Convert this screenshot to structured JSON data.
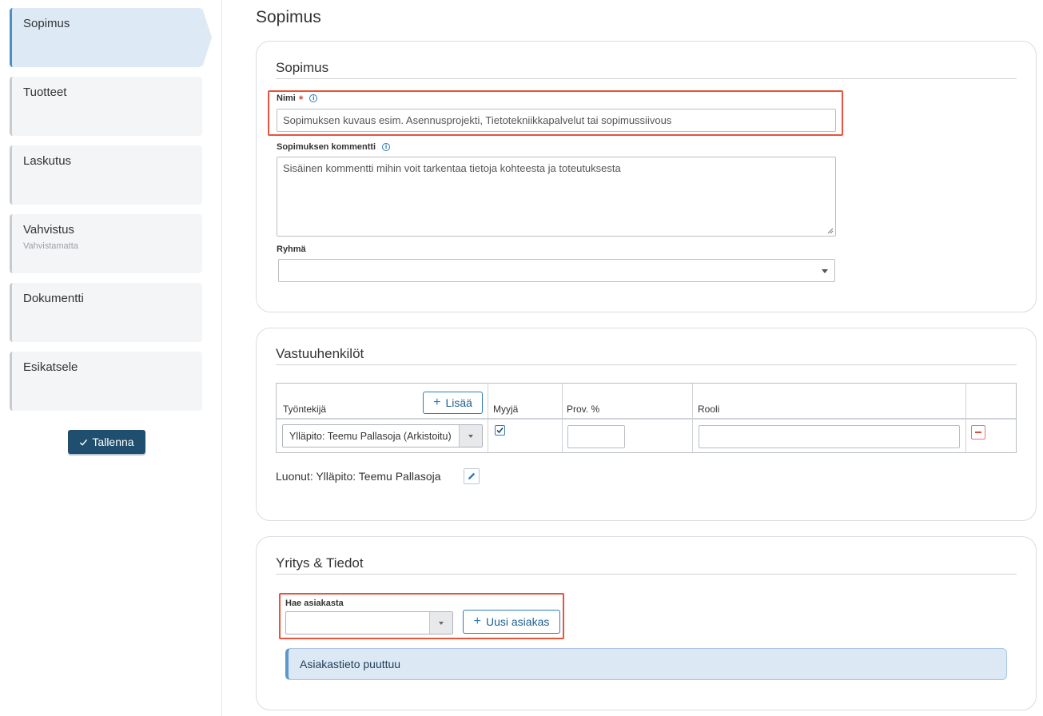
{
  "sidebar": {
    "items": [
      {
        "label": "Sopimus",
        "sub": ""
      },
      {
        "label": "Tuotteet",
        "sub": ""
      },
      {
        "label": "Laskutus",
        "sub": ""
      },
      {
        "label": "Vahvistus",
        "sub": "Vahvistamatta"
      },
      {
        "label": "Dokumentti",
        "sub": ""
      },
      {
        "label": "Esikatsele",
        "sub": ""
      }
    ],
    "active_index": 0,
    "save_label": "Tallenna"
  },
  "page": {
    "title": "Sopimus"
  },
  "contract_card": {
    "title": "Sopimus",
    "name_label": "Nimi",
    "name_required_mark": "*",
    "name_placeholder": "Sopimuksen kuvaus esim. Asennusprojekti, Tietotekniikkapalvelut tai sopimussiivous",
    "comment_label": "Sopimuksen kommentti",
    "comment_placeholder": "Sisäinen kommentti mihin voit tarkentaa tietoja kohteesta ja toteutuksesta",
    "group_label": "Ryhmä",
    "group_value": ""
  },
  "responsible_card": {
    "title": "Vastuuhenkilöt",
    "columns": {
      "employee": "Työntekijä",
      "seller": "Myyjä",
      "commission": "Prov. %",
      "role": "Rooli"
    },
    "add_label": "Lisää",
    "rows": [
      {
        "employee": "Ylläpito: Teemu Pallasoja (Arkistoitu)",
        "seller": true,
        "commission": "",
        "role": ""
      }
    ],
    "created_by": "Luonut: Ylläpito: Teemu Pallasoja"
  },
  "company_card": {
    "title": "Yritys & Tiedot",
    "search_label": "Hae asiakasta",
    "search_value": "",
    "new_customer_label": "Uusi asiakas",
    "alert_text": "Asiakastieto puuttuu"
  },
  "colors": {
    "primary_dark": "#1f4e6e",
    "accent_blue": "#2f7ab8",
    "highlight_red": "#e8533c",
    "active_nav_bg": "#dde9f5",
    "alert_bg": "#dce9f5"
  },
  "icons": {
    "save": "check-icon",
    "info": "info-icon",
    "add": "plus-icon",
    "remove": "minus-icon",
    "edit": "pencil-icon",
    "dropdown": "caret-down-icon"
  }
}
